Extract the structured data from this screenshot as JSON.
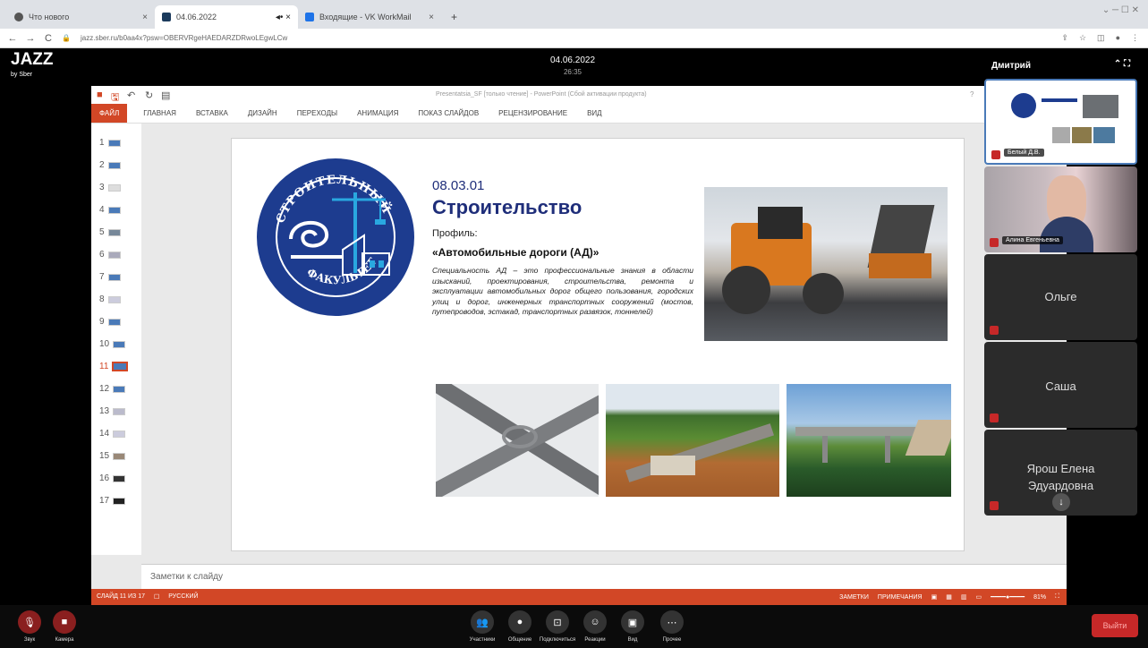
{
  "browser": {
    "tabs": [
      {
        "title": "Что нового",
        "close": "×"
      },
      {
        "title": "04.06.2022",
        "close": "×"
      },
      {
        "title": "Входящие - VK WorkMail",
        "close": "×"
      }
    ],
    "new_tab": "+",
    "url": "jazz.sber.ru/b0aa4x?psw=OBERVRgeHAEDARZDRwoLEgwLCw",
    "window_controls": "⌄  ─  ☐  ✕"
  },
  "jazz": {
    "brand": "JAZZ",
    "brand_sub": "by Sber",
    "date": "04.06.2022",
    "time": "26:35"
  },
  "powerpoint": {
    "title": "Presentatsia_SF [только чтение] - PowerPoint (Сбой активации продукта)",
    "help": "?",
    "ribbon_tabs": [
      "ФАЙЛ",
      "ГЛАВНАЯ",
      "ВСТАВКА",
      "ДИЗАЙН",
      "ПЕРЕХОДЫ",
      "АНИМАЦИЯ",
      "ПОКАЗ СЛАЙДОВ",
      "РЕЦЕНЗИРОВАНИЕ",
      "ВИД"
    ],
    "thumbnails": [
      "1",
      "2",
      "3",
      "4",
      "5",
      "6",
      "7",
      "8",
      "9",
      "10",
      "11",
      "12",
      "13",
      "14",
      "15",
      "16",
      "17"
    ],
    "selected_slide": 11,
    "notes_placeholder": "Заметки к слайду",
    "status_left": [
      "СЛАЙД 11 ИЗ 17",
      "РУССКИЙ"
    ],
    "status_right": [
      "ЗАМЕТКИ",
      "ПРИМЕЧАНИЯ"
    ],
    "zoom": "81%"
  },
  "slide": {
    "logo_top": "СТРОИТЕЛЬНЫЙ",
    "logo_bottom": "ФАКУЛЬТЕТ",
    "code": "08.03.01",
    "name": "Строительство",
    "profile_label": "Профиль:",
    "profile_name": "«Автомобильные дороги (АД)»",
    "description": "Специальность АД – это профессиональные знания в области изысканий, проектирования, строительства, ремонта и эксплуатации автомобильных дорог общего пользования, городских улиц и дорог, инженерных транспортных сооружений (мостов, путепроводов, эстакад, транспортных развязок, тоннелей)"
  },
  "participants_panel": {
    "owner": "Дмитрий",
    "controls": "⌃  ⛶",
    "tiles": [
      {
        "name": "Белый Д.В."
      },
      {
        "name": "Алина Евгеньевна"
      },
      {
        "name": "Ольге"
      },
      {
        "name": "Саша"
      },
      {
        "name": "Ярош Елена Эдуардовна"
      }
    ],
    "scroll_down": "↓"
  },
  "toolbar": {
    "sound": "Звук",
    "camera": "Камера",
    "participants": "Участники",
    "chat": "Общение",
    "share": "Подключиться",
    "reactions": "Реакции",
    "view": "Вид",
    "more": "Прочее",
    "leave": "Выйти"
  },
  "colors": {
    "ppt_accent": "#d24726",
    "slide_title": "#1f2e7a",
    "logo_blue": "#1d3c8f",
    "leave_red": "#c62828"
  }
}
